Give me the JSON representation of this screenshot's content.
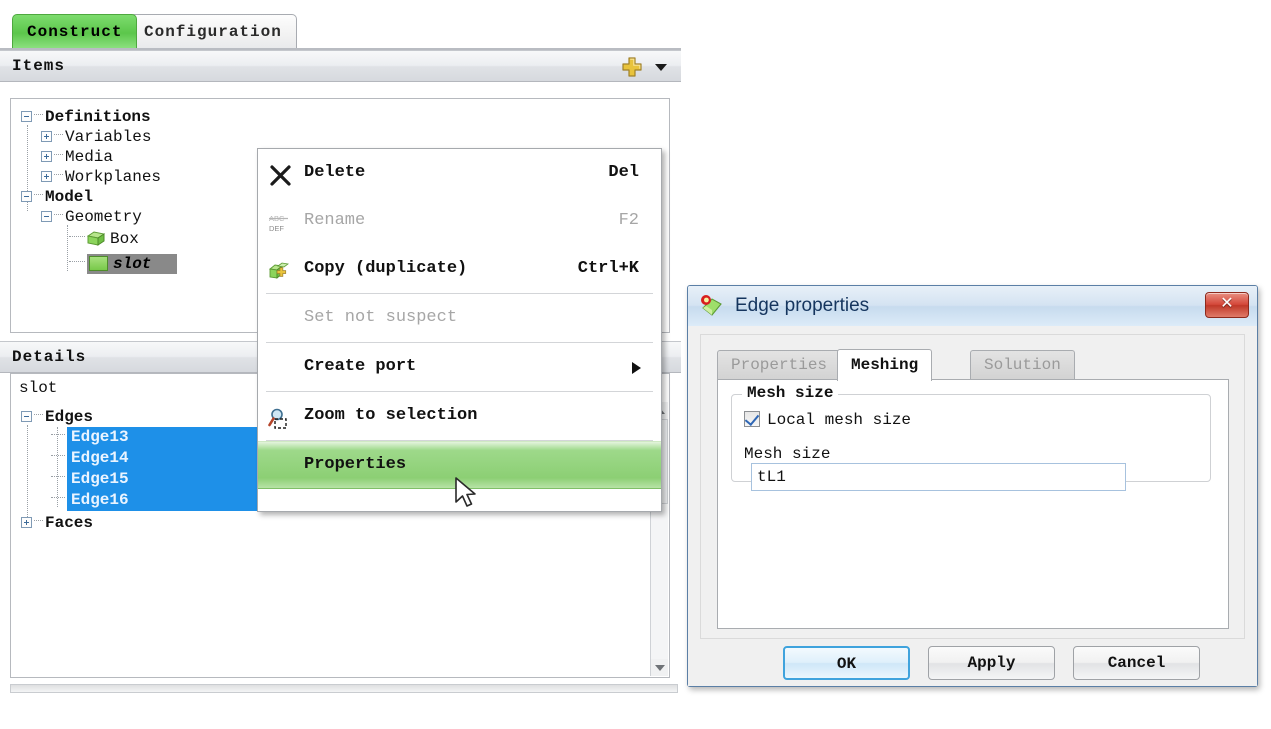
{
  "left_panel": {
    "tabs": [
      {
        "label": "Construct",
        "active": true
      },
      {
        "label": "Configuration",
        "active": false
      }
    ],
    "items_section": {
      "title": "Items",
      "add_icon": "plus-icon",
      "dropdown_icon": "chevron-down-icon"
    },
    "items_tree": [
      {
        "label": "Definitions",
        "state": "expanded",
        "bold": true,
        "depth": 0
      },
      {
        "label": "Variables",
        "state": "collapsed",
        "bold": false,
        "depth": 1
      },
      {
        "label": "Media",
        "state": "collapsed",
        "bold": false,
        "depth": 1
      },
      {
        "label": "Workplanes",
        "state": "collapsed",
        "bold": false,
        "depth": 1
      },
      {
        "label": "Model",
        "state": "expanded",
        "bold": true,
        "depth": 0
      },
      {
        "label": "Geometry",
        "state": "expanded",
        "bold": false,
        "depth": 1
      },
      {
        "label": "Box",
        "state": "leaf",
        "bold": false,
        "depth": 2,
        "icon": "cube-icon"
      },
      {
        "label": "slot",
        "state": "leaf",
        "bold": true,
        "depth": 2,
        "icon": "face-icon",
        "selected": true
      }
    ],
    "details_section": {
      "title": "Details",
      "object_name": "slot"
    },
    "details_tree": [
      {
        "label": "Edges",
        "state": "expanded",
        "bold": true
      },
      {
        "label": "Edge13",
        "state": "leaf",
        "selected": true
      },
      {
        "label": "Edge14",
        "state": "leaf",
        "selected": true
      },
      {
        "label": "Edge15",
        "state": "leaf",
        "selected": true
      },
      {
        "label": "Edge16",
        "state": "leaf",
        "selected": true
      },
      {
        "label": "Faces",
        "state": "collapsed",
        "bold": true
      }
    ]
  },
  "context_menu": {
    "items": [
      {
        "label": "Delete",
        "accel": "Del",
        "icon": "delete-x-icon",
        "disabled": false,
        "highlight": false
      },
      {
        "label": "Rename",
        "accel": "F2",
        "icon": "abc-def-rename-icon",
        "disabled": true,
        "highlight": false
      },
      {
        "label": "Copy (duplicate)",
        "accel": "Ctrl+K",
        "icon": "copy-duplicate-icon",
        "disabled": false,
        "highlight": false
      },
      {
        "label": "Set not suspect",
        "accel": "",
        "icon": "",
        "disabled": true,
        "highlight": false
      },
      {
        "label": "Create port",
        "accel": "",
        "icon": "",
        "disabled": false,
        "highlight": false,
        "submenu": true
      },
      {
        "label": "Zoom to selection",
        "accel": "",
        "icon": "zoom-to-selection-icon",
        "disabled": false,
        "highlight": false
      },
      {
        "label": "Properties",
        "accel": "",
        "icon": "",
        "disabled": false,
        "highlight": true
      }
    ]
  },
  "dialog": {
    "title": "Edge properties",
    "icon": "edge-properties-icon",
    "close_label": "✕",
    "tabs": [
      {
        "label": "Properties",
        "active": false
      },
      {
        "label": "Meshing",
        "active": true
      },
      {
        "label": "Solution",
        "active": false
      }
    ],
    "groupbox_title": "Mesh size",
    "checkbox_label": "Local mesh size",
    "checkbox_checked": true,
    "mesh_size_label": "Mesh size",
    "mesh_size_value": "tL1",
    "mesh_size_placeholder": "",
    "buttons": [
      {
        "label": "OK",
        "default": true
      },
      {
        "label": "Apply",
        "default": false
      },
      {
        "label": "Cancel",
        "default": false
      }
    ]
  },
  "colors": {
    "active_tab_green": "#5cc64b",
    "selection_blue": "#1e90e8",
    "menu_highlight_green": "#8ccf74",
    "slot_selection_gray": "#898989",
    "dialog_title_blue": "#15355e",
    "close_button_red": "#c03828"
  }
}
